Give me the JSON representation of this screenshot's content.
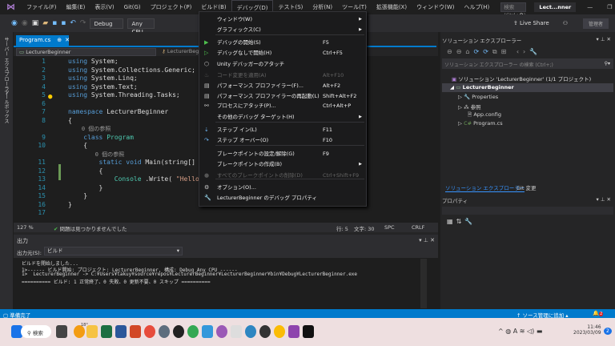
{
  "menubar": {
    "items": [
      "ファイル(F)",
      "編集(E)",
      "表示(V)",
      "Git(G)",
      "プロジェクト(P)",
      "ビルド(B)",
      "デバッグ(D)",
      "テスト(S)",
      "分析(N)",
      "ツール(T)",
      "拡張機能(X)",
      "ウィンドウ(W)",
      "ヘルプ(H)"
    ],
    "search_placeholder": "検索 (Ctrl+Q)",
    "window_title": "Lect...nner",
    "minimize": "—",
    "restore": "❐",
    "close": "✕"
  },
  "toolbar": {
    "config": "Debug",
    "platform": "Any CPU",
    "live_share": "Live Share",
    "admin": "管理者"
  },
  "left_tabs": [
    "サーバー エクスプローラー",
    "ツールボックス"
  ],
  "document": {
    "tab": "Program.cs",
    "nav_left": "LecturerBeginner",
    "nav_mid": "LecturerBegi"
  },
  "code": {
    "lines": [
      {
        "n": "1",
        "parts": [
          [
            "kw",
            "using"
          ],
          [
            "",
            "System;"
          ]
        ]
      },
      {
        "n": "2",
        "parts": [
          [
            "kw",
            "using"
          ],
          [
            "",
            "System.Collections.Generic;"
          ]
        ]
      },
      {
        "n": "3",
        "parts": [
          [
            "kw",
            "using"
          ],
          [
            "",
            "System.Linq;"
          ]
        ]
      },
      {
        "n": "4",
        "parts": [
          [
            "kw",
            "using"
          ],
          [
            "",
            "System.Text;"
          ]
        ]
      },
      {
        "n": "5",
        "parts": [
          [
            "kw",
            "using"
          ],
          [
            "",
            "System.Threading.Tasks;"
          ]
        ]
      },
      {
        "n": "6",
        "parts": []
      },
      {
        "n": "7",
        "parts": [
          [
            "kw",
            "namespace"
          ],
          [
            "",
            "LecturerBeginner"
          ]
        ]
      },
      {
        "n": "8",
        "parts": [
          [
            "",
            "{"
          ]
        ]
      },
      {
        "n": "",
        "parts": [
          [
            "lens",
            "    0 個の参照"
          ]
        ]
      },
      {
        "n": "9",
        "parts": [
          [
            "kw",
            "    class"
          ],
          [
            "ty",
            "Program"
          ]
        ]
      },
      {
        "n": "10",
        "parts": [
          [
            "",
            "    {"
          ]
        ]
      },
      {
        "n": "",
        "parts": [
          [
            "lens",
            "        0 個の参照"
          ]
        ]
      },
      {
        "n": "11",
        "parts": [
          [
            "kw",
            "        static void"
          ],
          [
            "",
            "Main(string[]"
          ]
        ]
      },
      {
        "n": "12",
        "parts": [
          [
            "",
            "        {"
          ]
        ]
      },
      {
        "n": "13",
        "parts": [
          [
            "ty",
            "            Console"
          ],
          [
            "",
            ".Write("
          ],
          [
            "str",
            "\"HelloW"
          ]
        ]
      },
      {
        "n": "14",
        "parts": [
          [
            "",
            "        }"
          ]
        ]
      },
      {
        "n": "15",
        "parts": [
          [
            "",
            "    }"
          ]
        ]
      },
      {
        "n": "16",
        "parts": [
          [
            "",
            "}"
          ]
        ]
      },
      {
        "n": "17",
        "parts": []
      }
    ]
  },
  "editor_status": {
    "zoom": "127 %",
    "issues": "問題は見つかりませんでした",
    "line": "行: 5",
    "char": "文字: 30",
    "spc": "SPC",
    "crlf": "CRLF"
  },
  "output": {
    "title": "出力",
    "source_label": "出力元(S):",
    "source": "ビルド",
    "lines": [
      "ビルドを開始しました...",
      "1>------ ビルド開始: プロジェクト: LecturerBeginner, 構成: Debug Any CPU ------",
      "1>  LecturerBeginner -> C:¥Users¥takuy¥source¥repos¥LecturerBeginner¥LecturerBeginner¥bin¥Debug¥LecturerBeginner.exe",
      "========== ビルド: 1 正常終了、0 失敗、0 更新不要、0 スキップ =========="
    ]
  },
  "solution_explorer": {
    "title": "ソリューション エクスプローラー",
    "search_placeholder": "ソリューション エクスプローラー の検索 (Ctrl+;)",
    "solution": "ソリューション 'LecturerBeginner' (1/1 プロジェクト)",
    "project": "LecturerBeginner",
    "items": [
      "Properties",
      "参照",
      "App.config",
      "Program.cs"
    ],
    "tabs": [
      "ソリューション エクスプローラー",
      "Git 変更"
    ]
  },
  "properties": {
    "title": "プロパティ"
  },
  "debug_menu": {
    "items": [
      {
        "label": "ウィンドウ(W)",
        "shortcut": "",
        "icon": "",
        "sub": true
      },
      {
        "label": "グラフィックス(C)",
        "shortcut": "",
        "icon": "",
        "sub": true
      },
      {
        "label": "デバッグの開始(S)",
        "shortcut": "F5",
        "icon": "play-icon"
      },
      {
        "label": "デバッグなしで開始(H)",
        "shortcut": "Ctrl+F5",
        "icon": "play-outline-icon"
      },
      {
        "label": "Unity デバッガーのアタッチ",
        "shortcut": "",
        "icon": "unity-icon"
      },
      {
        "label": "コード変更を適用(A)",
        "shortcut": "Alt+F10",
        "icon": "flame-icon",
        "disabled": true
      },
      {
        "label": "パフォーマンス プロファイラー(F)...",
        "shortcut": "Alt+F2",
        "icon": "profiler-icon"
      },
      {
        "label": "パフォーマンス プロファイラーの再起動(L)",
        "shortcut": "Shift+Alt+F2",
        "icon": "profiler-icon"
      },
      {
        "label": "プロセスにアタッチ(P)...",
        "shortcut": "Ctrl+Alt+P",
        "icon": "attach-icon"
      },
      {
        "label": "その他のデバッグ ターゲット(H)",
        "shortcut": "",
        "icon": "",
        "sub": true
      },
      {
        "label": "ステップ イン(L)",
        "shortcut": "F11",
        "icon": "step-into-icon"
      },
      {
        "label": "ステップ オーバー(O)",
        "shortcut": "F10",
        "icon": "step-over-icon"
      },
      {
        "label": "ブレークポイントの設定/解除(G)",
        "shortcut": "F9",
        "icon": ""
      },
      {
        "label": "ブレークポイントの作成(B)",
        "shortcut": "",
        "icon": "",
        "sub": true
      },
      {
        "label": "すべてのブレークポイントの削除(D)",
        "shortcut": "Ctrl+Shift+F9",
        "icon": "delete-breakpoints-icon",
        "disabled": true
      },
      {
        "label": "オプション(O)...",
        "shortcut": "",
        "icon": "gear-icon"
      },
      {
        "label": "LecturerBeginner のデバッグ プロパティ",
        "shortcut": "",
        "icon": "wrench-icon"
      }
    ]
  },
  "status_bar": {
    "ready": "準備完了",
    "source_control": "ソース管理に追加 ▴",
    "notifications": "2"
  },
  "taskbar": {
    "search": "検索",
    "weather": "18°",
    "time": "11:46",
    "date": "2023/03/09",
    "badge": "2"
  },
  "colors": {
    "accent": "#007acc",
    "highlight_box": "#e51919"
  }
}
